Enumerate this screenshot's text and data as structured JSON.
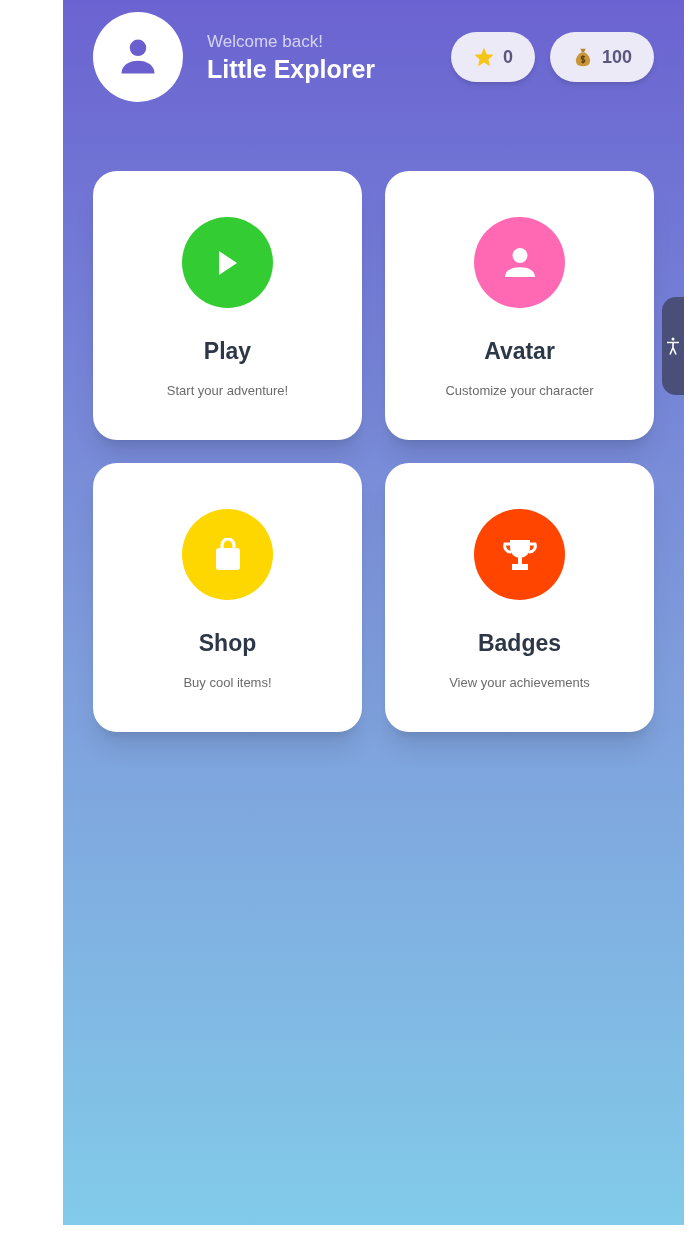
{
  "header": {
    "greeting": "Welcome back!",
    "username": "Little Explorer",
    "counters": [
      {
        "kind": "star",
        "value": "0"
      },
      {
        "kind": "money",
        "value": "100"
      }
    ]
  },
  "menu": [
    {
      "kind": "play",
      "color": "#33cc33",
      "title": "Play",
      "subtitle": "Start your adventure!"
    },
    {
      "kind": "person",
      "color": "#ff69b4",
      "title": "Avatar",
      "subtitle": "Customize your character"
    },
    {
      "kind": "bag",
      "color": "#ffd700",
      "title": "Shop",
      "subtitle": "Buy cool items!"
    },
    {
      "kind": "trophy",
      "color": "#ff4500",
      "title": "Badges",
      "subtitle": "View your achievements"
    }
  ]
}
